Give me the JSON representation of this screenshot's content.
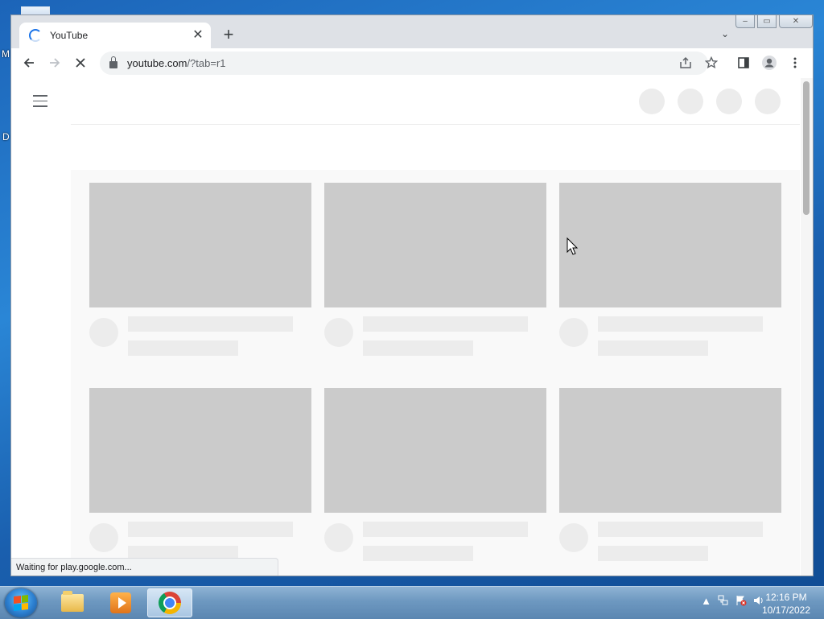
{
  "desktop": {
    "fragment_top": "M",
    "fragment_mid": "D"
  },
  "browser": {
    "tab": {
      "title": "YouTube",
      "close_glyph": "✕"
    },
    "new_tab_glyph": "+",
    "tab_search_glyph": "⌄",
    "window_controls": {
      "minimize": "–",
      "maximize": "▭",
      "close": "✕"
    },
    "toolbar": {
      "back_icon": "arrow-left-icon",
      "forward_icon": "arrow-right-icon",
      "stop_icon": "stop-loading-icon",
      "url_host": "youtube.com",
      "url_path": "/?tab=r1",
      "share_icon": "share-icon",
      "bookmark_icon": "star-icon",
      "sidepanel_icon": "side-panel-icon",
      "profile_icon": "profile-icon",
      "menu_icon": "kebab-menu-icon"
    },
    "status_text": "Waiting for play.google.com..."
  },
  "page": {
    "masthead_placeholders": 4,
    "video_placeholders": 6
  },
  "taskbar": {
    "apps": [
      "Windows Explorer",
      "Windows Media Player",
      "Google Chrome"
    ],
    "clock_time": "12:16 PM",
    "clock_date": "10/17/2022",
    "tray_icons": [
      "show-hidden-icons-icon",
      "network-icon",
      "action-center-flag-icon",
      "volume-icon"
    ]
  },
  "colors": {
    "skeleton_dark": "#cbcbcb",
    "skeleton_light": "#ececec",
    "accent": "#1a73e8"
  }
}
